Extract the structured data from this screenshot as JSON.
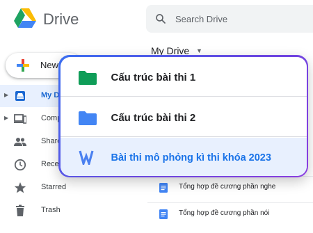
{
  "app": {
    "brand": "Drive"
  },
  "search": {
    "placeholder": "Search Drive"
  },
  "sidebar": {
    "new_label": "New",
    "items": [
      {
        "label": "My Drive",
        "icon": "my-drive-icon"
      },
      {
        "label": "Computers",
        "icon": "computer-icon"
      },
      {
        "label": "Shared with me",
        "icon": "shared-icon"
      },
      {
        "label": "Recent",
        "icon": "clock-icon"
      },
      {
        "label": "Starred",
        "icon": "star-icon"
      },
      {
        "label": "Trash",
        "icon": "trash-icon"
      }
    ]
  },
  "main": {
    "breadcrumb": "My Drive",
    "files": [
      {
        "name": "Tổng hợp đề cương phần nghe",
        "icon": "doc-icon"
      },
      {
        "name": "Tổng hợp đề cương phần nói",
        "icon": "doc-icon"
      }
    ]
  },
  "popup": {
    "items": [
      {
        "label": "Cấu trúc bài thi 1",
        "icon": "folder-icon",
        "color": "#0f9d58"
      },
      {
        "label": "Cấu trúc bài thi 2",
        "icon": "folder-icon",
        "color": "#4285f4"
      },
      {
        "label": "Bài thi mô phỏng kì thi khóa 2023",
        "icon": "word-doc-icon",
        "color": "#4285f4"
      }
    ]
  },
  "colors": {
    "accent": "#1a73e8",
    "active_bg": "#e8f0fe",
    "border_start": "#3b6ff0",
    "border_end": "#8a3ee0"
  }
}
